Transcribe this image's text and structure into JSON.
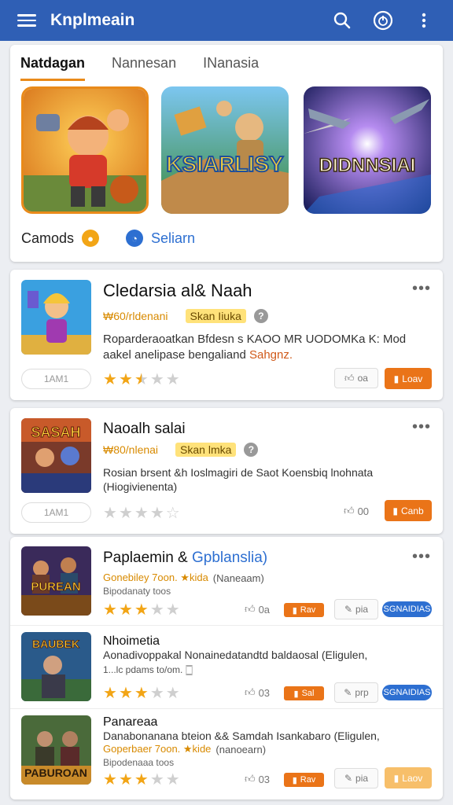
{
  "app": {
    "title": "Knplmeain"
  },
  "tabs": [
    "Natdagan",
    "Nannesan",
    "INanasia"
  ],
  "featured": [
    {
      "name": "",
      "color": "#e8a23a"
    },
    {
      "name": "KSIARLISY",
      "color": "#4a9a4a"
    },
    {
      "name": "DIDNNSIAI",
      "color": "#2c2f8a"
    }
  ],
  "chips": [
    {
      "label": "Camods",
      "icon": "coin-icon",
      "color": "#f2a516"
    },
    {
      "label": "Seliarn",
      "icon": "chat-icon",
      "color": "#2d6fd1"
    }
  ],
  "apps": [
    {
      "name": "Cledarsia al& Naah",
      "tag1": "₩60/rldenani",
      "tag2": "Skan Iiuka",
      "desc1": "Roparderaoatkan Bfdesn s KAOO MR UODOMKa K: Mod",
      "desc2a": "aakel anelipase bengaliand ",
      "desc2b": "Sahgnz.",
      "pill": "1AM1",
      "rating": 2.5,
      "like": "oa",
      "action": "Loav"
    },
    {
      "name": "Naoalh salai",
      "tag1": "₩80/nlenai",
      "tag2": "Skan lmka",
      "desc1": "Rosian brsent &h Ioslmagiri de Saot Koensbiq lnohnata",
      "desc2": "(Hiogivienenta)",
      "pill": "1AM1",
      "rating": 0,
      "like": "00",
      "action": "Canb",
      "thumb": "SASAH"
    }
  ],
  "list": [
    {
      "name": "Paplaemin & ",
      "name2": "Gpblanslia)",
      "sub1": "Gonebiley 7oon. ★kida",
      "sub1b": "(Naneaam)",
      "sub2": "Bipodanaty toos",
      "rating": 3,
      "like": "0a",
      "orange": "Rav",
      "gray": "pia",
      "blue": "SGNAIDIAS",
      "thumb": "PUREAN"
    },
    {
      "name": "Nhoimetia",
      "desc": "Aonadivoppakal Nonainedatandtd baldaosal (Eligulen,",
      "sub2": "1...lc pdams to/om. 🀆",
      "rating": 3,
      "like": "03",
      "orange": "Sal",
      "gray": "prp",
      "blue": "SGNAIDIAS",
      "thumb": "BAUBEK"
    },
    {
      "name": "Panareaa",
      "desc": "Danabonanana bteion && Samdah Isankabaro (Eligulen,",
      "sub1": "Goperbaer 7oon. ★kide",
      "sub1b": "(nanoearn)",
      "sub2": "Bipodenaaa toos",
      "rating": 3,
      "like": "03",
      "orange": "Rav",
      "gray": "pia",
      "blue": "Laov",
      "thumb": "PABUROAN"
    }
  ]
}
